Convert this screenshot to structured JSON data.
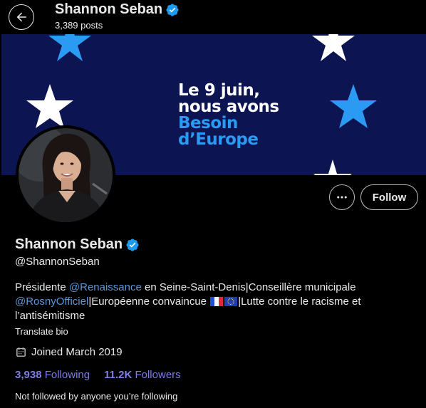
{
  "header": {
    "back_label": "back",
    "name": "Shannon Seban",
    "posts": "3,389 posts"
  },
  "banner": {
    "line1": "Le 9 juin,",
    "line2": "nous avons",
    "line3": "Besoin",
    "line4": "d’Europe",
    "colors": {
      "background": "#0d1452",
      "accent": "#2a9af3",
      "star_white": "#ffffff",
      "star_blue": "#2a9af3"
    }
  },
  "actions": {
    "more_icon": "more-icon",
    "follow_label": "Follow"
  },
  "profile": {
    "name": "Shannon Seban",
    "verified_icon": "verified-badge-icon",
    "handle": "@ShannonSeban",
    "bio": {
      "part1": "Présidente ",
      "mention1": "@Renaissance",
      "part2": " en Seine-Saint-Denis|Conseillère municipale ",
      "mention2": "@RosnyOfficiel",
      "part3": "|Européenne convaincue ",
      "flags": [
        "french-flag-icon",
        "eu-flag-icon"
      ],
      "part4": "|Lutte contre le racisme et l’antisémitisme"
    },
    "translate_label": "Translate bio",
    "joined": "Joined March 2019",
    "following_count": "3,938",
    "following_label": "Following",
    "followers_count": "11.2K",
    "followers_label": "Followers",
    "not_followed": "Not followed by anyone you’re following"
  }
}
